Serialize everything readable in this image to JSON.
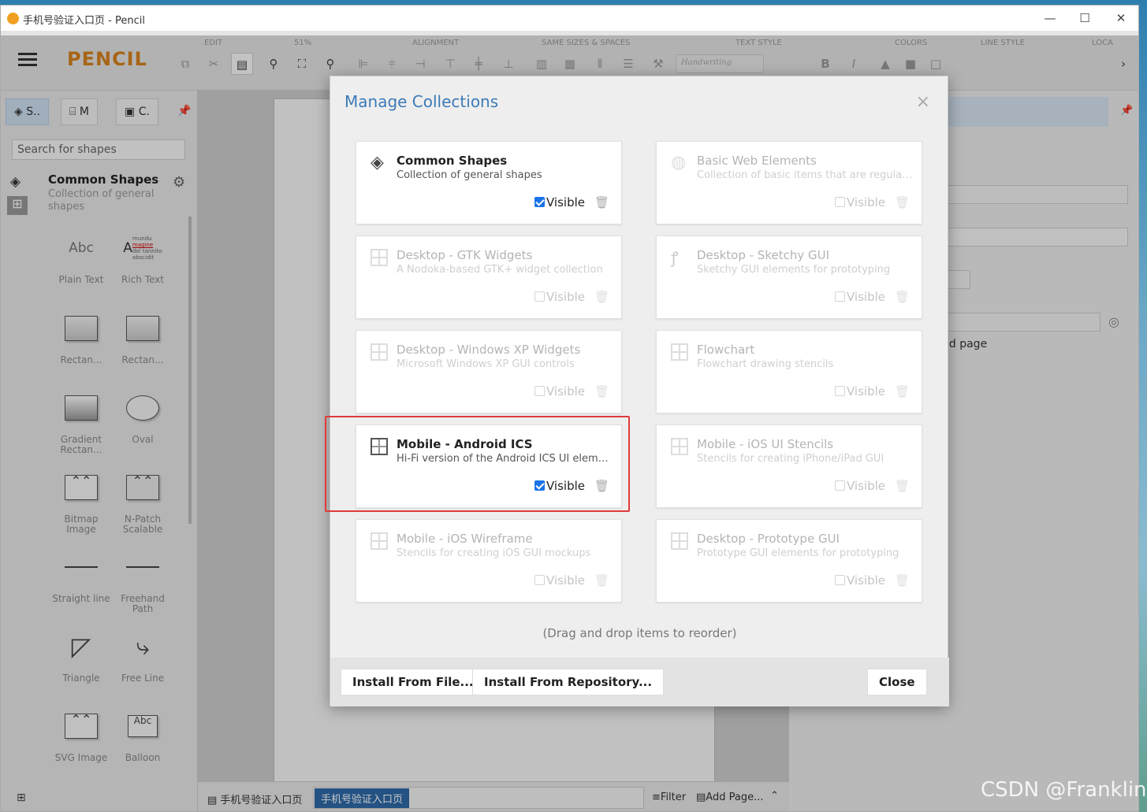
{
  "window": {
    "title": "手机号验证入口页 - Pencil",
    "min": "—",
    "max": "☐",
    "close": "✕"
  },
  "toolbar": {
    "logo": "PENCIL",
    "groups": [
      "EDIT",
      "51%",
      "ALIGNMENT",
      "SAME SIZES & SPACES",
      "TEXT STYLE",
      "COLORS",
      "LINE STYLE",
      "LOCA"
    ],
    "font": "Handwriting"
  },
  "left_panel": {
    "tabs": [
      "S..",
      "M",
      "C."
    ],
    "search_placeholder": "Search for shapes",
    "collection_title": "Common Shapes",
    "collection_desc": "Collection of general shapes",
    "shapes": [
      "Plain Text",
      "Rich Text",
      "Rectan...",
      "Rectan...",
      "Gradient Rectan...",
      "Oval",
      "Bitmap Image",
      "N-Patch Scalable",
      "Straight line",
      "Freehand Path",
      "Triangle",
      "Free Line",
      "SVG Image",
      "Balloon"
    ],
    "plain_text_sample": "Abc",
    "rich_text_sample": "A",
    "rich_text_lines": [
      "mundu",
      "magine",
      "dei tannito",
      "abscidit"
    ],
    "balloon_sample": "Abc"
  },
  "right_panel": {
    "partial_text": "nd page"
  },
  "bottom_bar": {
    "page_label": "手机号验证入口页",
    "page_tab": "手机号验证入口页",
    "filter": "Filter",
    "add_page": "Add Page..."
  },
  "dialog": {
    "title": "Manage Collections",
    "close": "×",
    "hint": "(Drag and drop items to reorder)",
    "buttons": {
      "install_file": "Install From File...",
      "install_repo": "Install From Repository...",
      "close": "Close"
    },
    "visible_label": "Visible",
    "collections": [
      {
        "name": "Common Shapes",
        "desc": "Collection of general shapes",
        "visible": true,
        "icon": "layers-icon"
      },
      {
        "name": "Basic Web Elements",
        "desc": "Collection of basic items that are regularl...",
        "visible": false,
        "icon": "globe-icon"
      },
      {
        "name": "Desktop - GTK Widgets",
        "desc": "A Nodoka-based GTK+ widget collection",
        "visible": false,
        "icon": "grid-icon"
      },
      {
        "name": "Desktop - Sketchy GUI",
        "desc": "Sketchy GUI elements for prototyping",
        "visible": false,
        "icon": "squiggle-icon"
      },
      {
        "name": "Desktop - Windows XP Widgets",
        "desc": "Microsoft Windows XP GUI controls",
        "visible": false,
        "icon": "grid-icon"
      },
      {
        "name": "Flowchart",
        "desc": "Flowchart drawing stencils",
        "visible": false,
        "icon": "grid-icon"
      },
      {
        "name": "Mobile - Android ICS",
        "desc": "Hi-Fi version of the Android ICS UI eleme...",
        "visible": true,
        "icon": "grid-icon"
      },
      {
        "name": "Mobile - iOS UI Stencils",
        "desc": "Stencils for creating iPhone/iPad GUI",
        "visible": false,
        "icon": "grid-icon"
      },
      {
        "name": "Mobile - iOS Wireframe",
        "desc": "Stencils for creating iOS GUI mockups",
        "visible": false,
        "icon": "grid-icon"
      },
      {
        "name": "Desktop - Prototype GUI",
        "desc": "Prototype GUI elements for prototyping",
        "visible": false,
        "icon": "grid-icon"
      }
    ]
  },
  "watermark": "CSDN @Franklin"
}
